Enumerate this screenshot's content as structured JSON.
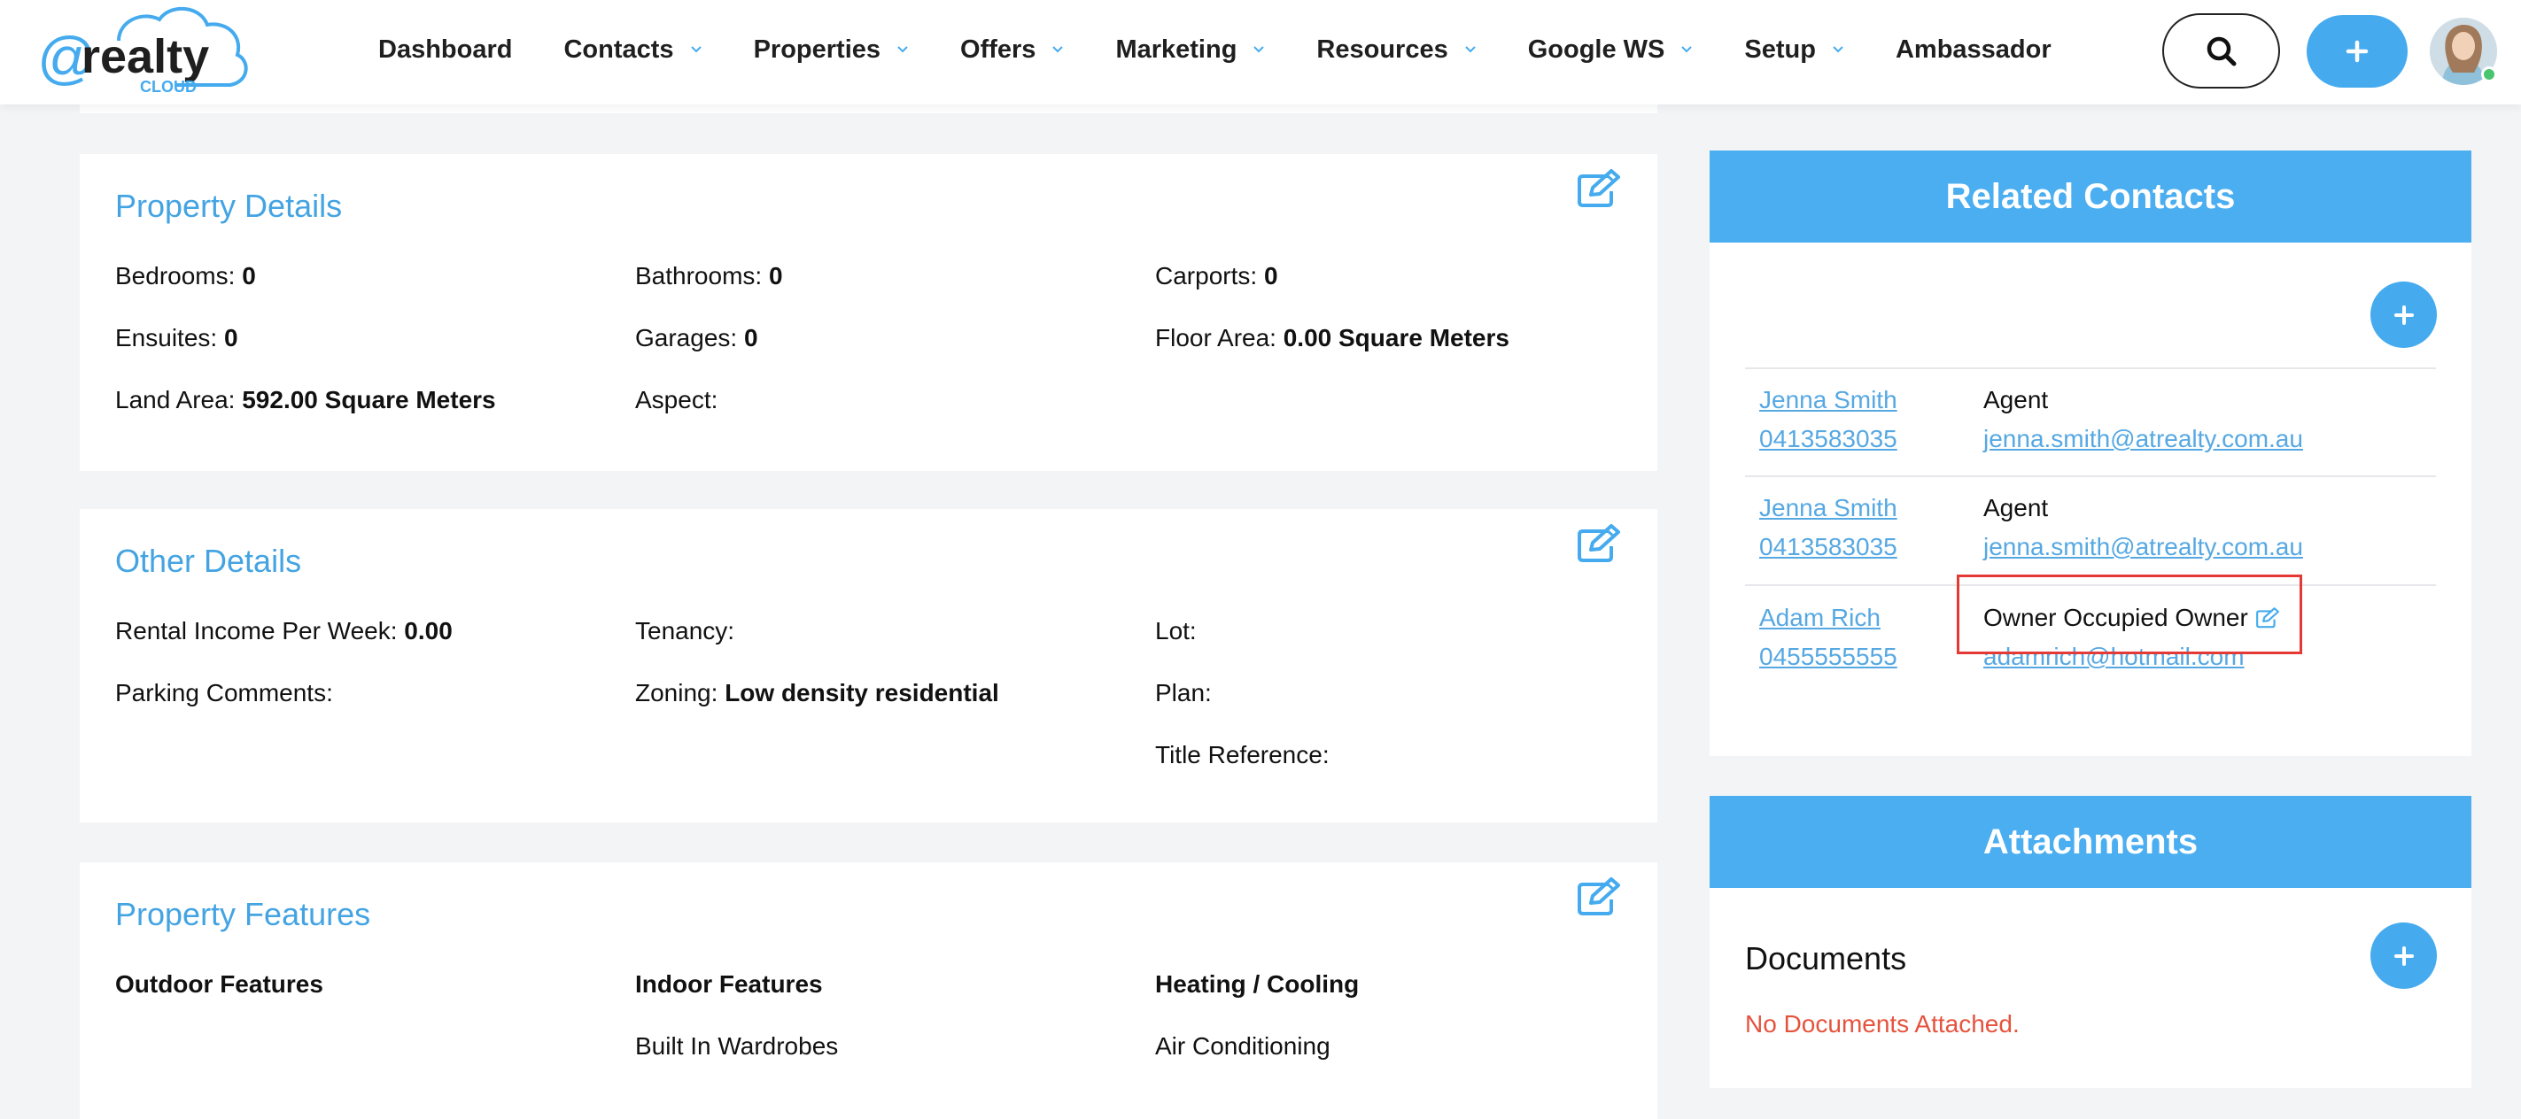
{
  "brand": {
    "logo_prefix": "@",
    "logo_word": "realty",
    "logo_sub": "CLOUD",
    "accent": "#45abee"
  },
  "nav": {
    "dashboard": "Dashboard",
    "contacts": "Contacts",
    "properties": "Properties",
    "offers": "Offers",
    "marketing": "Marketing",
    "resources": "Resources",
    "google_ws": "Google WS",
    "setup": "Setup",
    "ambassador": "Ambassador"
  },
  "property_details": {
    "title": "Property Details",
    "bedrooms_label": "Bedrooms:",
    "bedrooms": "0",
    "bathrooms_label": "Bathrooms:",
    "bathrooms": "0",
    "carports_label": "Carports:",
    "carports": "0",
    "ensuites_label": "Ensuites:",
    "ensuites": "0",
    "garages_label": "Garages:",
    "garages": "0",
    "floor_area_label": "Floor Area:",
    "floor_area": "0.00 Square Meters",
    "land_area_label": "Land Area:",
    "land_area": "592.00 Square Meters",
    "aspect_label": "Aspect:",
    "aspect": ""
  },
  "other_details": {
    "title": "Other Details",
    "rental_label": "Rental Income Per Week:",
    "rental": "0.00",
    "tenancy_label": "Tenancy:",
    "tenancy": "",
    "lot_label": "Lot:",
    "lot": "",
    "parking_label": "Parking Comments:",
    "parking": "",
    "zoning_label": "Zoning:",
    "zoning": "Low density residential",
    "plan_label": "Plan:",
    "plan": "",
    "title_ref_label": "Title Reference:",
    "title_ref": ""
  },
  "property_features": {
    "title": "Property Features",
    "outdoor_head": "Outdoor Features",
    "indoor_head": "Indoor Features",
    "heating_head": "Heating / Cooling",
    "indoor_items": [
      "Built In Wardrobes"
    ],
    "heating_items": [
      "Air Conditioning"
    ]
  },
  "related_contacts": {
    "title": "Related Contacts",
    "rows": [
      {
        "name": "Jenna Smith",
        "phone": "0413583035",
        "role": "Agent",
        "email": "jenna.smith@atrealty.com.au"
      },
      {
        "name": "Jenna Smith",
        "phone": "0413583035",
        "role": "Agent",
        "email": "jenna.smith@atrealty.com.au"
      },
      {
        "name": "Adam Rich",
        "phone": "0455555555",
        "role": "Owner Occupied Owner",
        "email": "adamrich@hotmail.com"
      }
    ]
  },
  "attachments": {
    "title": "Attachments",
    "documents_title": "Documents",
    "empty_message": "No Documents Attached."
  }
}
